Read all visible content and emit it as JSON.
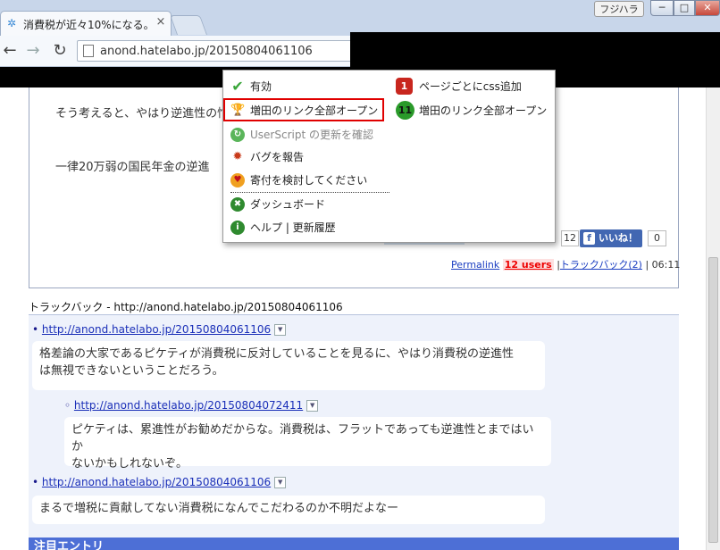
{
  "browser": {
    "tab_title": "消費税が近々10%になる。",
    "tab_close": "×",
    "user_badge": "フジハラ",
    "window_min": "─",
    "window_max": "□",
    "window_close": "✕",
    "url": "anond.hatelabo.jp/20150804061106"
  },
  "article": {
    "para1": "そう考えると、やはり逆進性の忙",
    "para2": "一律20万弱の国民年金の逆進",
    "share_count": "12",
    "fb_label": "いいね！",
    "fb_count": "0",
    "permalink": "Permalink",
    "users": "12 users",
    "trackback_link": "トラックバック(2)",
    "time": "06:11",
    "separator": "|"
  },
  "trackbacks": {
    "header": "トラックバック - http://anond.hatelabo.jp/20150804061106",
    "items": [
      {
        "url": "http://anond.hatelabo.jp/20150804061106",
        "text_line1": "格差論の大家であるピケティが消費税に反対していることを見るに、やはり消費税の逆進性",
        "text_line2": "は無視できないということだろう。"
      },
      {
        "url": "http://anond.hatelabo.jp/20150804072411",
        "text_line1": "ピケティは、累進性がお勧めだからな。消費税は、フラットであっても逆進性とまではいか",
        "text_line2": "ないかもしれないぞ。"
      },
      {
        "url": "http://anond.hatelabo.jp/20150804061106",
        "text_line1": "まるで増税に貢献してない消費税になんでこだわるのか不明だよなー"
      }
    ],
    "next_section": "注目エントリ"
  },
  "menu": {
    "left": [
      {
        "label": "有効",
        "icon": "check-icon",
        "color": "#3aa63a"
      },
      {
        "label": "増田のリンク全部オープン",
        "icon": "trophy-icon",
        "color": "#c48a1a"
      },
      {
        "label": "UserScript の更新を確認",
        "icon": "refresh-icon",
        "color": "#5ab55a"
      },
      {
        "label": "バグを報告",
        "icon": "bug-icon",
        "color": "#c83a1a"
      },
      {
        "label": "寄付を検討してください",
        "icon": "heart-icon",
        "color": "#e8762a"
      },
      {
        "label": "ダッシュボード",
        "icon": "dashboard-icon",
        "color": "#2f8a2f"
      },
      {
        "label": "ヘルプ | 更新履歴",
        "icon": "info-icon",
        "color": "#2f8a2f"
      }
    ],
    "right": [
      {
        "label": "ページごとにcss追加",
        "badge": "1",
        "color": "#c8261e"
      },
      {
        "label": "増田のリンク全部オープン",
        "badge": "11",
        "color": "#2a9a2a"
      }
    ]
  }
}
